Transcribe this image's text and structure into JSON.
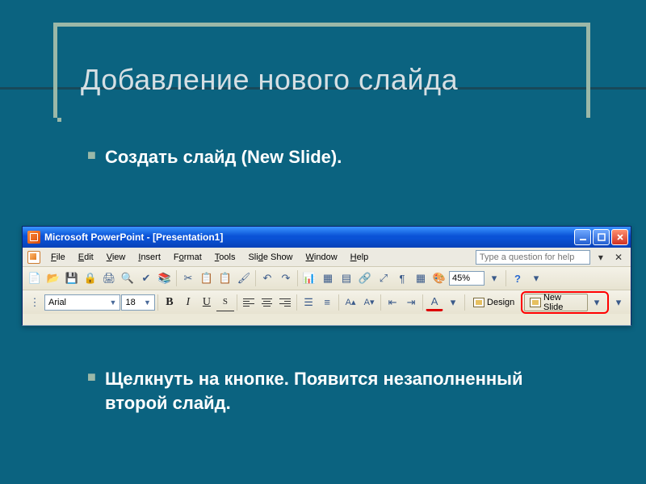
{
  "slide": {
    "title": "Добавление нового слайда",
    "bullets": [
      "Создать слайд (New Slide).",
      "Щелкнуть на кнопке. Появится незаполненный второй слайд."
    ]
  },
  "ppwindow": {
    "title": "Microsoft PowerPoint - [Presentation1]",
    "menu": [
      "File",
      "Edit",
      "View",
      "Insert",
      "Format",
      "Tools",
      "Slide Show",
      "Window",
      "Help"
    ],
    "help_placeholder": "Type a question for help",
    "zoom": "45%",
    "font": "Arial",
    "font_size": "18",
    "design_label": "Design",
    "new_slide_label": "New Slide"
  }
}
